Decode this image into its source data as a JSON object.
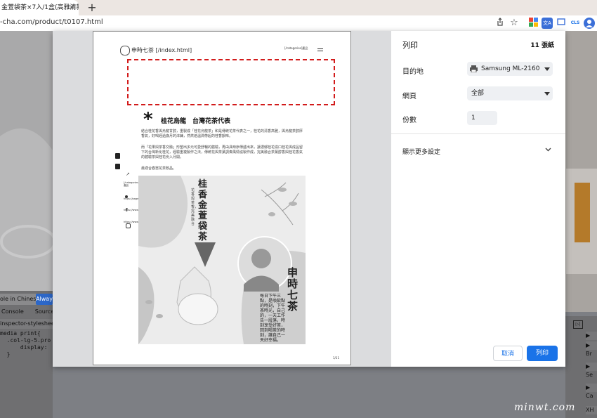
{
  "browser": {
    "tab_title": "金萱袋茶×7入/1盒(高雅清新",
    "tab_close": "×",
    "new_tab": "+",
    "url": "-cha.com/product/t0107.html",
    "toolbar_icons": [
      "share-icon",
      "star-icon",
      "extension-icon",
      "translate-icon",
      "bookmark-icon",
      "cls-icon",
      "profile-icon"
    ],
    "cls_label": "CLS"
  },
  "devtools": {
    "banner_text": "ole in Chinese!",
    "banner_button": "Alway",
    "tabs": [
      "Console",
      "Sources"
    ],
    "stylesheet": "inspector-stylesheet*",
    "code_lines": [
      "media print{",
      "  .col-lg-5.pro",
      "      display:",
      "  }"
    ],
    "right_labels": [
      "▶ W",
      "▶ Br",
      "▶ Se",
      "▶ Ca",
      "XH"
    ]
  },
  "print_dialog": {
    "title": "列印",
    "sheet_count": "11 張紙",
    "destination_label": "目的地",
    "destination_value": "Samsung ML-2160 Se",
    "pages_label": "網頁",
    "pages_value": "全部",
    "copies_label": "份數",
    "copies_value": "1",
    "more_settings": "顯示更多設定",
    "cancel": "取消",
    "print": "列印"
  },
  "preview": {
    "logo_text": "申時七茶 [/index.html]",
    "nav_text": "[/categories]產品",
    "heading_star": "*",
    "heading": "桂花烏龍　台灣花茶代表",
    "para1": "結合桂花香與烏龍甘醇，重製成「桂花烏龍茶」和是傳統花茶代表之一，桂花的清香高雅，與烏龍茶醇厚香氣，好喝經過歲月的淬鍊，然烘焙溫潤帶起的桂香韻味。",
    "para2": "而「花果與茶香交融」形塑出多元可愛舒暢的體驗，再由具時序傳遞出來，讓濃郁桂花滋口桂花與成品留下的台灣新化桂花，經驗重複製作之法，傳統花與茶葉調奏風情協製作成，完美融合茶葉醇香與桂花香氣的體驗茶與桂花份入月開。",
    "para3": "最適合春當花茶飲品。",
    "side_links": [
      "[/categories] 產品",
      "https://page.line.me/7cha/",
      "https://www.facebook.com/7cha.tw/",
      "https://www.instagram.com/7cha.tw/"
    ],
    "poster_title": "桂香金萱袋茶",
    "poster_sub": "花香與茶香，完美融合",
    "poster_brand": "申時七茶",
    "poster_poem": "每日下午三點，是喚飲點的時刻，下午茶時光，自己的，一天工作告一段落，時刻享受好茶，回到喝茶的時刻，讓自己一天好幸福。",
    "page_number": "1/11"
  }
}
